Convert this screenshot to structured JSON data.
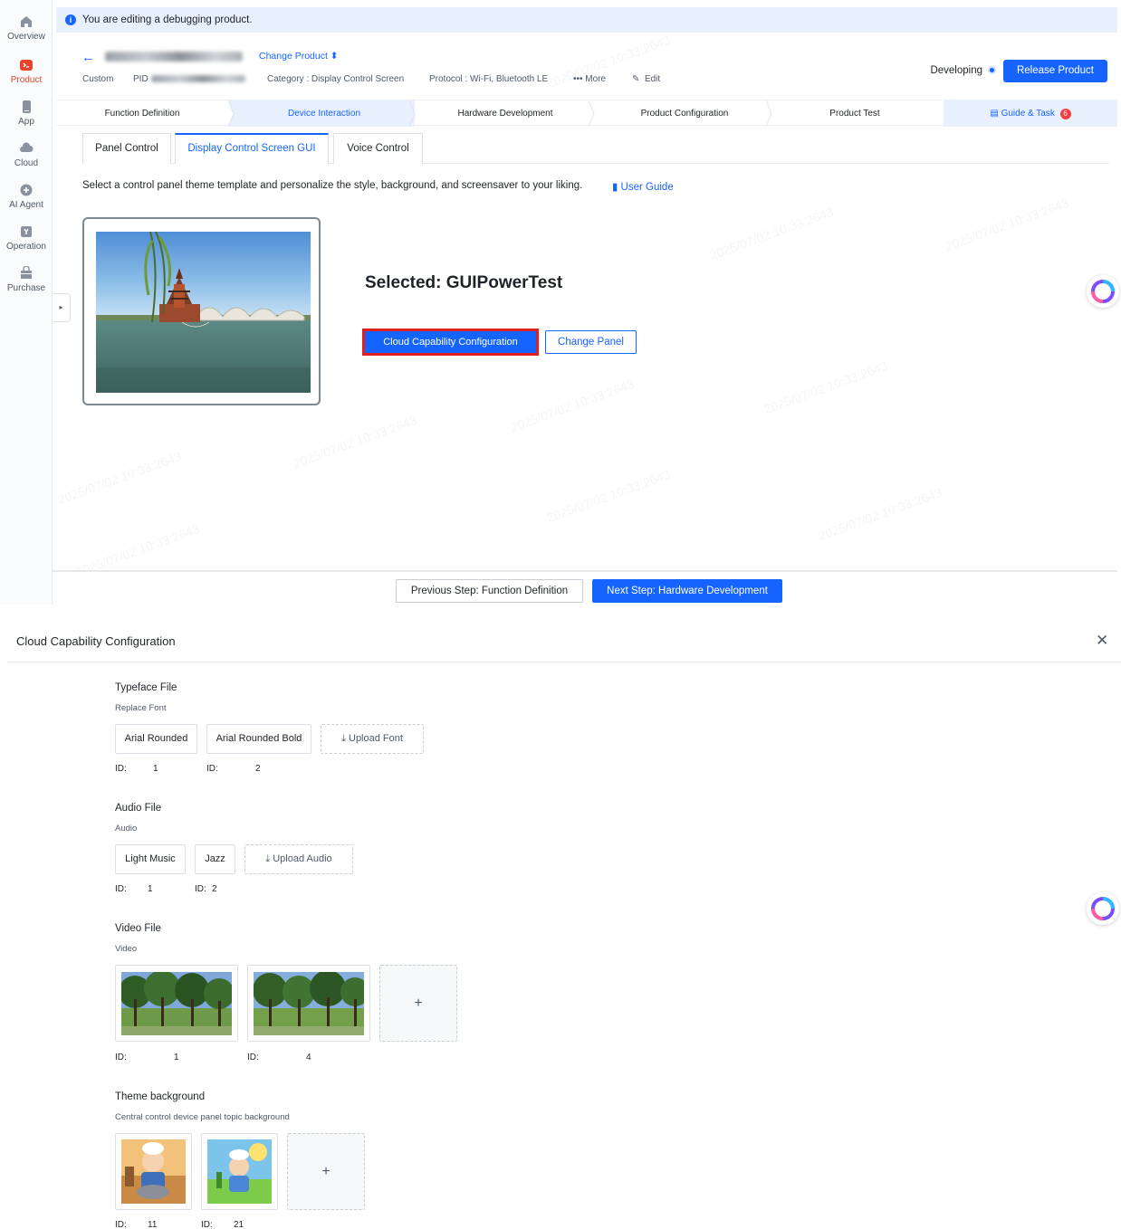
{
  "nav": {
    "items": [
      {
        "label": "Overview",
        "icon": "home-icon"
      },
      {
        "label": "Product",
        "icon": "product-icon"
      },
      {
        "label": "App",
        "icon": "app-icon"
      },
      {
        "label": "Cloud",
        "icon": "cloud-icon"
      },
      {
        "label": "AI Agent",
        "icon": "ai-agent-icon"
      },
      {
        "label": "Operation",
        "icon": "operation-icon"
      },
      {
        "label": "Purchase",
        "icon": "purchase-icon"
      }
    ],
    "collapse_glyph": "▸"
  },
  "notice": {
    "text": "You are editing a debugging product."
  },
  "header": {
    "back_glyph": "←",
    "change_product": "Change Product ⬍",
    "custom": "Custom",
    "pid_label": "PID",
    "category": "Category : Display Control Screen",
    "protocol": "Protocol : Wi-Fi, Bluetooth LE",
    "more": "More",
    "edit": "Edit",
    "status": "Developing",
    "release_button": "Release Product"
  },
  "steps": {
    "items": [
      "Function Definition",
      "Device Interaction",
      "Hardware Development",
      "Product Configuration",
      "Product Test"
    ],
    "guide": "Guide & Task",
    "guide_badge": "6"
  },
  "subtabs": [
    "Panel Control",
    "Display Control Screen GUI",
    "Voice Control"
  ],
  "main": {
    "description": "Select a control panel theme template and personalize the style, background, and screensaver to your liking.",
    "user_guide": "User Guide",
    "selected": "Selected: GUIPowerTest",
    "cloud_button": "Cloud Capability Configuration",
    "change_panel": "Change Panel"
  },
  "footer": {
    "prev": "Previous Step: Function Definition",
    "next": "Next Step: Hardware Development"
  },
  "dialog": {
    "title": "Cloud Capability Configuration",
    "close_glyph": "✕",
    "typeface": {
      "title": "Typeface File",
      "sub": "Replace Font",
      "options": [
        {
          "label": "Arial Rounded",
          "id_label": "ID:",
          "id": "1"
        },
        {
          "label": "Arial Rounded Bold",
          "id_label": "ID:",
          "id": "2"
        }
      ],
      "upload": "⤓ Upload Font"
    },
    "audio": {
      "title": "Audio File",
      "sub": "Audio",
      "options": [
        {
          "label": "Light Music",
          "id_label": "ID:",
          "id": "1"
        },
        {
          "label": "Jazz",
          "id_label": "ID:",
          "id": "2"
        }
      ],
      "upload": "⤓ Upload Audio"
    },
    "video": {
      "title": "Video File",
      "sub": "Video",
      "items": [
        {
          "id_label": "ID:",
          "id": "1"
        },
        {
          "id_label": "ID:",
          "id": "4"
        }
      ],
      "add_glyph": "+"
    },
    "theme": {
      "title": "Theme background",
      "sub": "Central control device panel topic background",
      "items": [
        {
          "id_label": "ID:",
          "id": "11"
        },
        {
          "id_label": "ID:",
          "id": "21"
        }
      ],
      "add_glyph": "+"
    }
  },
  "colors": {
    "primary": "#1664ff",
    "active_nav": "#e8412c",
    "highlight_border": "#e02020",
    "notice_bg": "#e8f0fe"
  }
}
